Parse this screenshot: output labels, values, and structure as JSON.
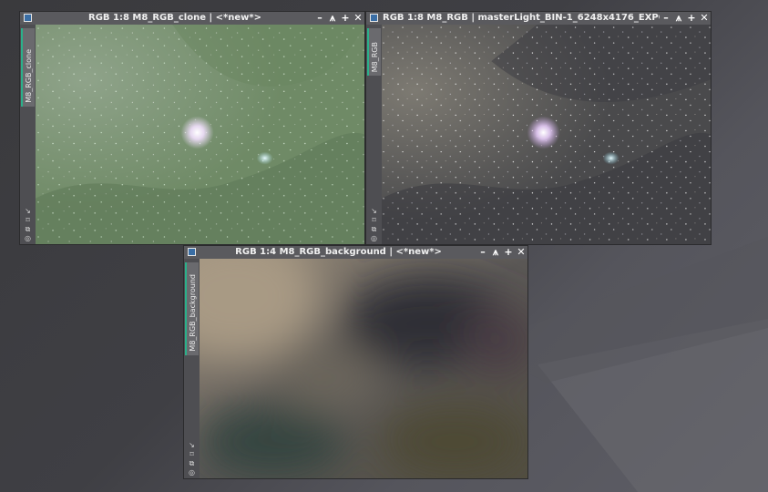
{
  "windows": [
    {
      "title": "RGB 1:8 M8_RGB_clone | <*new*>",
      "tab": "M8_RGB_clone"
    },
    {
      "title": "RGB 1:8 M8_RGB | masterLight_BIN-1_6248x4176_EXPO...",
      "tab": "M8_RGB"
    },
    {
      "title": "RGB 1:4 M8_RGB_background | <*new*>",
      "tab": "M8_RGB_background"
    }
  ],
  "controls": {
    "shade": "–",
    "restore": "⩚",
    "maximize": "+",
    "close": "✕"
  },
  "sidebar_icons": {
    "zoom": "↘",
    "fit": "⌑",
    "clone": "⧉",
    "target": "◎"
  },
  "colors": {
    "tab_accent": "#2bb08a",
    "titlebar": "#5a5a5e"
  }
}
